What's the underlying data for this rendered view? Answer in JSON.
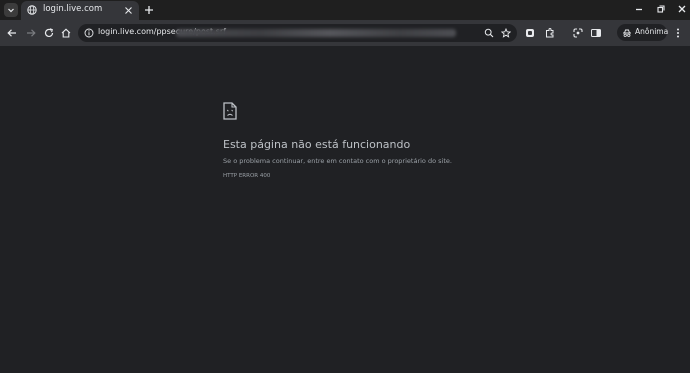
{
  "browser": {
    "tab": {
      "title": "login.live.com"
    },
    "address_bar": {
      "url": "login.live.com/ppsecure/post.srf"
    },
    "profile": {
      "label": "Anônima"
    },
    "colors": {
      "background": "#202124",
      "toolbar": "#35363a",
      "tabstrip": "#1f1f1f"
    }
  },
  "error_page": {
    "icon": "sad-page-icon",
    "title": "Esta página não está funcionando",
    "description": "Se o problema continuar, entre em contato com o proprietário do site.",
    "error_code": "HTTP ERROR 400"
  }
}
